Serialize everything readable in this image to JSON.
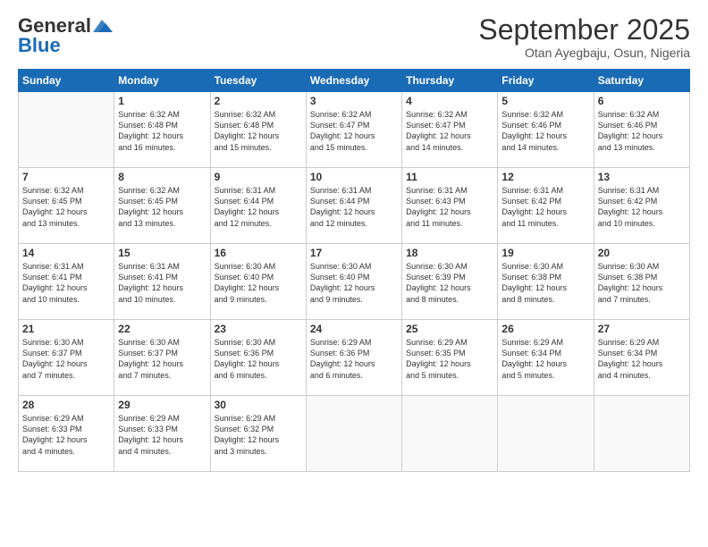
{
  "header": {
    "logo_line1": "General",
    "logo_line2": "Blue",
    "month": "September 2025",
    "location": "Otan Ayegbaju, Osun, Nigeria"
  },
  "weekdays": [
    "Sunday",
    "Monday",
    "Tuesday",
    "Wednesday",
    "Thursday",
    "Friday",
    "Saturday"
  ],
  "weeks": [
    [
      {
        "day": null,
        "info": null
      },
      {
        "day": "1",
        "sunrise": "6:32 AM",
        "sunset": "6:48 PM",
        "daylight": "12 hours and 16 minutes."
      },
      {
        "day": "2",
        "sunrise": "6:32 AM",
        "sunset": "6:48 PM",
        "daylight": "12 hours and 15 minutes."
      },
      {
        "day": "3",
        "sunrise": "6:32 AM",
        "sunset": "6:47 PM",
        "daylight": "12 hours and 15 minutes."
      },
      {
        "day": "4",
        "sunrise": "6:32 AM",
        "sunset": "6:47 PM",
        "daylight": "12 hours and 14 minutes."
      },
      {
        "day": "5",
        "sunrise": "6:32 AM",
        "sunset": "6:46 PM",
        "daylight": "12 hours and 14 minutes."
      },
      {
        "day": "6",
        "sunrise": "6:32 AM",
        "sunset": "6:46 PM",
        "daylight": "12 hours and 13 minutes."
      }
    ],
    [
      {
        "day": "7",
        "sunrise": "6:32 AM",
        "sunset": "6:45 PM",
        "daylight": "12 hours and 13 minutes."
      },
      {
        "day": "8",
        "sunrise": "6:32 AM",
        "sunset": "6:45 PM",
        "daylight": "12 hours and 13 minutes."
      },
      {
        "day": "9",
        "sunrise": "6:31 AM",
        "sunset": "6:44 PM",
        "daylight": "12 hours and 12 minutes."
      },
      {
        "day": "10",
        "sunrise": "6:31 AM",
        "sunset": "6:44 PM",
        "daylight": "12 hours and 12 minutes."
      },
      {
        "day": "11",
        "sunrise": "6:31 AM",
        "sunset": "6:43 PM",
        "daylight": "12 hours and 11 minutes."
      },
      {
        "day": "12",
        "sunrise": "6:31 AM",
        "sunset": "6:42 PM",
        "daylight": "12 hours and 11 minutes."
      },
      {
        "day": "13",
        "sunrise": "6:31 AM",
        "sunset": "6:42 PM",
        "daylight": "12 hours and 10 minutes."
      }
    ],
    [
      {
        "day": "14",
        "sunrise": "6:31 AM",
        "sunset": "6:41 PM",
        "daylight": "12 hours and 10 minutes."
      },
      {
        "day": "15",
        "sunrise": "6:31 AM",
        "sunset": "6:41 PM",
        "daylight": "12 hours and 10 minutes."
      },
      {
        "day": "16",
        "sunrise": "6:30 AM",
        "sunset": "6:40 PM",
        "daylight": "12 hours and 9 minutes."
      },
      {
        "day": "17",
        "sunrise": "6:30 AM",
        "sunset": "6:40 PM",
        "daylight": "12 hours and 9 minutes."
      },
      {
        "day": "18",
        "sunrise": "6:30 AM",
        "sunset": "6:39 PM",
        "daylight": "12 hours and 8 minutes."
      },
      {
        "day": "19",
        "sunrise": "6:30 AM",
        "sunset": "6:38 PM",
        "daylight": "12 hours and 8 minutes."
      },
      {
        "day": "20",
        "sunrise": "6:30 AM",
        "sunset": "6:38 PM",
        "daylight": "12 hours and 7 minutes."
      }
    ],
    [
      {
        "day": "21",
        "sunrise": "6:30 AM",
        "sunset": "6:37 PM",
        "daylight": "12 hours and 7 minutes."
      },
      {
        "day": "22",
        "sunrise": "6:30 AM",
        "sunset": "6:37 PM",
        "daylight": "12 hours and 7 minutes."
      },
      {
        "day": "23",
        "sunrise": "6:30 AM",
        "sunset": "6:36 PM",
        "daylight": "12 hours and 6 minutes."
      },
      {
        "day": "24",
        "sunrise": "6:29 AM",
        "sunset": "6:36 PM",
        "daylight": "12 hours and 6 minutes."
      },
      {
        "day": "25",
        "sunrise": "6:29 AM",
        "sunset": "6:35 PM",
        "daylight": "12 hours and 5 minutes."
      },
      {
        "day": "26",
        "sunrise": "6:29 AM",
        "sunset": "6:34 PM",
        "daylight": "12 hours and 5 minutes."
      },
      {
        "day": "27",
        "sunrise": "6:29 AM",
        "sunset": "6:34 PM",
        "daylight": "12 hours and 4 minutes."
      }
    ],
    [
      {
        "day": "28",
        "sunrise": "6:29 AM",
        "sunset": "6:33 PM",
        "daylight": "12 hours and 4 minutes."
      },
      {
        "day": "29",
        "sunrise": "6:29 AM",
        "sunset": "6:33 PM",
        "daylight": "12 hours and 4 minutes."
      },
      {
        "day": "30",
        "sunrise": "6:29 AM",
        "sunset": "6:32 PM",
        "daylight": "12 hours and 3 minutes."
      },
      {
        "day": null,
        "info": null
      },
      {
        "day": null,
        "info": null
      },
      {
        "day": null,
        "info": null
      },
      {
        "day": null,
        "info": null
      }
    ]
  ],
  "labels": {
    "sunrise": "Sunrise:",
    "sunset": "Sunset:",
    "daylight": "Daylight:"
  }
}
